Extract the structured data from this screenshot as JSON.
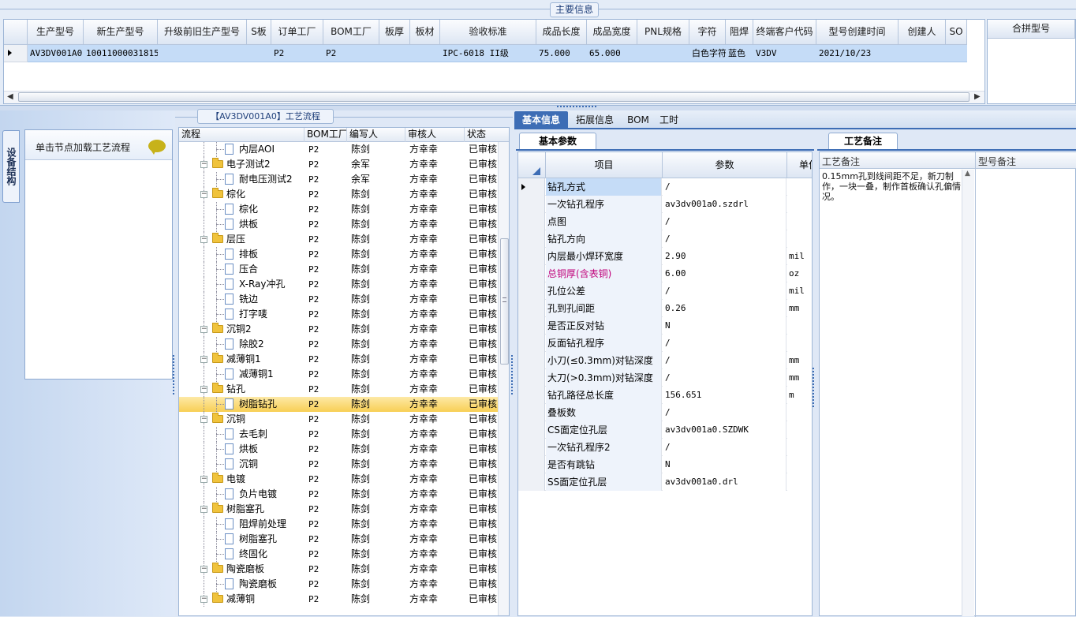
{
  "main_info": {
    "title": "主要信息",
    "columns": [
      "生产型号",
      "新生产型号",
      "升级前旧生产型号",
      "S板",
      "订单工厂",
      "BOM工厂",
      "板厚",
      "板材",
      "验收标准",
      "成品长度",
      "成品宽度",
      "PNL规格",
      "字符",
      "阻焊",
      "终端客户代码",
      "型号创建时间",
      "创建人",
      "SO"
    ],
    "row": [
      "AV3DV001A0",
      "10011000031815",
      "",
      "",
      "P2",
      "P2",
      "",
      "",
      "IPC-6018 II级",
      "75.000",
      "65.000",
      "",
      "白色字符",
      "蓝色",
      "V3DV",
      "2021/10/23",
      "",
      ""
    ],
    "merge_header": "合拼型号"
  },
  "side_tab": {
    "label": "设备结构"
  },
  "hint": {
    "text": "单击节点加载工艺流程"
  },
  "flow": {
    "title": "【AV3DV001A0】工艺流程",
    "columns": [
      "流程",
      "BOM工厂",
      "编写人",
      "审核人",
      "状态"
    ],
    "rows": [
      {
        "name": "内层AOI",
        "level": 1,
        "bom": "P2",
        "writer": "陈剑",
        "reviewer": "方幸幸",
        "status": "已审核"
      },
      {
        "name": "电子测试2",
        "level": 0,
        "bom": "P2",
        "writer": "余军",
        "reviewer": "方幸幸",
        "status": "已审核"
      },
      {
        "name": "耐电压测试2",
        "level": 1,
        "bom": "P2",
        "writer": "余军",
        "reviewer": "方幸幸",
        "status": "已审核"
      },
      {
        "name": "棕化",
        "level": 0,
        "bom": "P2",
        "writer": "陈剑",
        "reviewer": "方幸幸",
        "status": "已审核"
      },
      {
        "name": "棕化",
        "level": 1,
        "bom": "P2",
        "writer": "陈剑",
        "reviewer": "方幸幸",
        "status": "已审核"
      },
      {
        "name": "烘板",
        "level": 1,
        "bom": "P2",
        "writer": "陈剑",
        "reviewer": "方幸幸",
        "status": "已审核"
      },
      {
        "name": "层压",
        "level": 0,
        "bom": "P2",
        "writer": "陈剑",
        "reviewer": "方幸幸",
        "status": "已审核"
      },
      {
        "name": "排板",
        "level": 1,
        "bom": "P2",
        "writer": "陈剑",
        "reviewer": "方幸幸",
        "status": "已审核"
      },
      {
        "name": "压合",
        "level": 1,
        "bom": "P2",
        "writer": "陈剑",
        "reviewer": "方幸幸",
        "status": "已审核"
      },
      {
        "name": "X-Ray冲孔",
        "level": 1,
        "bom": "P2",
        "writer": "陈剑",
        "reviewer": "方幸幸",
        "status": "已审核"
      },
      {
        "name": "铣边",
        "level": 1,
        "bom": "P2",
        "writer": "陈剑",
        "reviewer": "方幸幸",
        "status": "已审核"
      },
      {
        "name": "打字唛",
        "level": 1,
        "bom": "P2",
        "writer": "陈剑",
        "reviewer": "方幸幸",
        "status": "已审核"
      },
      {
        "name": "沉铜2",
        "level": 0,
        "bom": "P2",
        "writer": "陈剑",
        "reviewer": "方幸幸",
        "status": "已审核"
      },
      {
        "name": "除胶2",
        "level": 1,
        "bom": "P2",
        "writer": "陈剑",
        "reviewer": "方幸幸",
        "status": "已审核"
      },
      {
        "name": "减薄铜1",
        "level": 0,
        "bom": "P2",
        "writer": "陈剑",
        "reviewer": "方幸幸",
        "status": "已审核"
      },
      {
        "name": "减薄铜1",
        "level": 1,
        "bom": "P2",
        "writer": "陈剑",
        "reviewer": "方幸幸",
        "status": "已审核"
      },
      {
        "name": "钻孔",
        "level": 0,
        "bom": "P2",
        "writer": "陈剑",
        "reviewer": "方幸幸",
        "status": "已审核"
      },
      {
        "name": "树脂钻孔",
        "level": 1,
        "bom": "P2",
        "writer": "陈剑",
        "reviewer": "方幸幸",
        "status": "已审核",
        "selected": true
      },
      {
        "name": "沉铜",
        "level": 0,
        "bom": "P2",
        "writer": "陈剑",
        "reviewer": "方幸幸",
        "status": "已审核"
      },
      {
        "name": "去毛刺",
        "level": 1,
        "bom": "P2",
        "writer": "陈剑",
        "reviewer": "方幸幸",
        "status": "已审核"
      },
      {
        "name": "烘板",
        "level": 1,
        "bom": "P2",
        "writer": "陈剑",
        "reviewer": "方幸幸",
        "status": "已审核"
      },
      {
        "name": "沉铜",
        "level": 1,
        "bom": "P2",
        "writer": "陈剑",
        "reviewer": "方幸幸",
        "status": "已审核"
      },
      {
        "name": "电镀",
        "level": 0,
        "bom": "P2",
        "writer": "陈剑",
        "reviewer": "方幸幸",
        "status": "已审核"
      },
      {
        "name": "负片电镀",
        "level": 1,
        "bom": "P2",
        "writer": "陈剑",
        "reviewer": "方幸幸",
        "status": "已审核"
      },
      {
        "name": "树脂塞孔",
        "level": 0,
        "bom": "P2",
        "writer": "陈剑",
        "reviewer": "方幸幸",
        "status": "已审核"
      },
      {
        "name": "阻焊前处理",
        "level": 1,
        "bom": "P2",
        "writer": "陈剑",
        "reviewer": "方幸幸",
        "status": "已审核"
      },
      {
        "name": "树脂塞孔",
        "level": 1,
        "bom": "P2",
        "writer": "陈剑",
        "reviewer": "方幸幸",
        "status": "已审核"
      },
      {
        "name": "终固化",
        "level": 1,
        "bom": "P2",
        "writer": "陈剑",
        "reviewer": "方幸幸",
        "status": "已审核"
      },
      {
        "name": "陶瓷磨板",
        "level": 0,
        "bom": "P2",
        "writer": "陈剑",
        "reviewer": "方幸幸",
        "status": "已审核"
      },
      {
        "name": "陶瓷磨板",
        "level": 1,
        "bom": "P2",
        "writer": "陈剑",
        "reviewer": "方幸幸",
        "status": "已审核"
      },
      {
        "name": "减薄铜",
        "level": 0,
        "bom": "P2",
        "writer": "陈剑",
        "reviewer": "方幸幸",
        "status": "已审核"
      }
    ]
  },
  "tabs": [
    "基本信息",
    "拓展信息",
    "BOM",
    "工时"
  ],
  "basic": {
    "subtab": "基本参数",
    "col_item": "项目",
    "col_param": "参数",
    "col_unit": "单位",
    "rows": [
      {
        "item": "钻孔方式",
        "param": "/",
        "unit": ""
      },
      {
        "item": "一次钻孔程序",
        "param": "av3dv001a0.szdrl",
        "unit": ""
      },
      {
        "item": "点图",
        "param": "/",
        "unit": ""
      },
      {
        "item": "钻孔方向",
        "param": "/",
        "unit": ""
      },
      {
        "item": "内层最小焊环宽度",
        "param": "2.90",
        "unit": "mil"
      },
      {
        "item": "总铜厚(含表铜)",
        "param": "6.00",
        "unit": "oz",
        "highlight": true
      },
      {
        "item": "孔位公差",
        "param": "/",
        "unit": "mil"
      },
      {
        "item": "孔到孔间距",
        "param": "0.26",
        "unit": "mm"
      },
      {
        "item": "是否正反对钻",
        "param": "N",
        "unit": ""
      },
      {
        "item": "反面钻孔程序",
        "param": "/",
        "unit": ""
      },
      {
        "item": "小刀(≤0.3mm)对钻深度",
        "param": "/",
        "unit": "mm"
      },
      {
        "item": "大刀(>0.3mm)对钻深度",
        "param": "/",
        "unit": "mm"
      },
      {
        "item": "钻孔路径总长度",
        "param": "156.651",
        "unit": "m"
      },
      {
        "item": "叠板数",
        "param": "/",
        "unit": ""
      },
      {
        "item": "CS面定位孔层",
        "param": "av3dv001a0.SZDWK",
        "unit": ""
      },
      {
        "item": "一次钻孔程序2",
        "param": "/",
        "unit": ""
      },
      {
        "item": "是否有跳钻",
        "param": "N",
        "unit": ""
      },
      {
        "item": "SS面定位孔层",
        "param": "av3dv001a0.drl",
        "unit": ""
      }
    ]
  },
  "remark": {
    "tab": "工艺备注",
    "col_process": "工艺备注",
    "col_model": "型号备注",
    "text": "0.15mm孔到线间距不足，新刀制作，一块一叠，制作首板确认孔偏情况。"
  },
  "colors": {
    "accent": "#3d6db5",
    "selected_row": "#c5dcf7",
    "tree_selected": "#fbd978",
    "highlight_text": "#c0007a"
  }
}
